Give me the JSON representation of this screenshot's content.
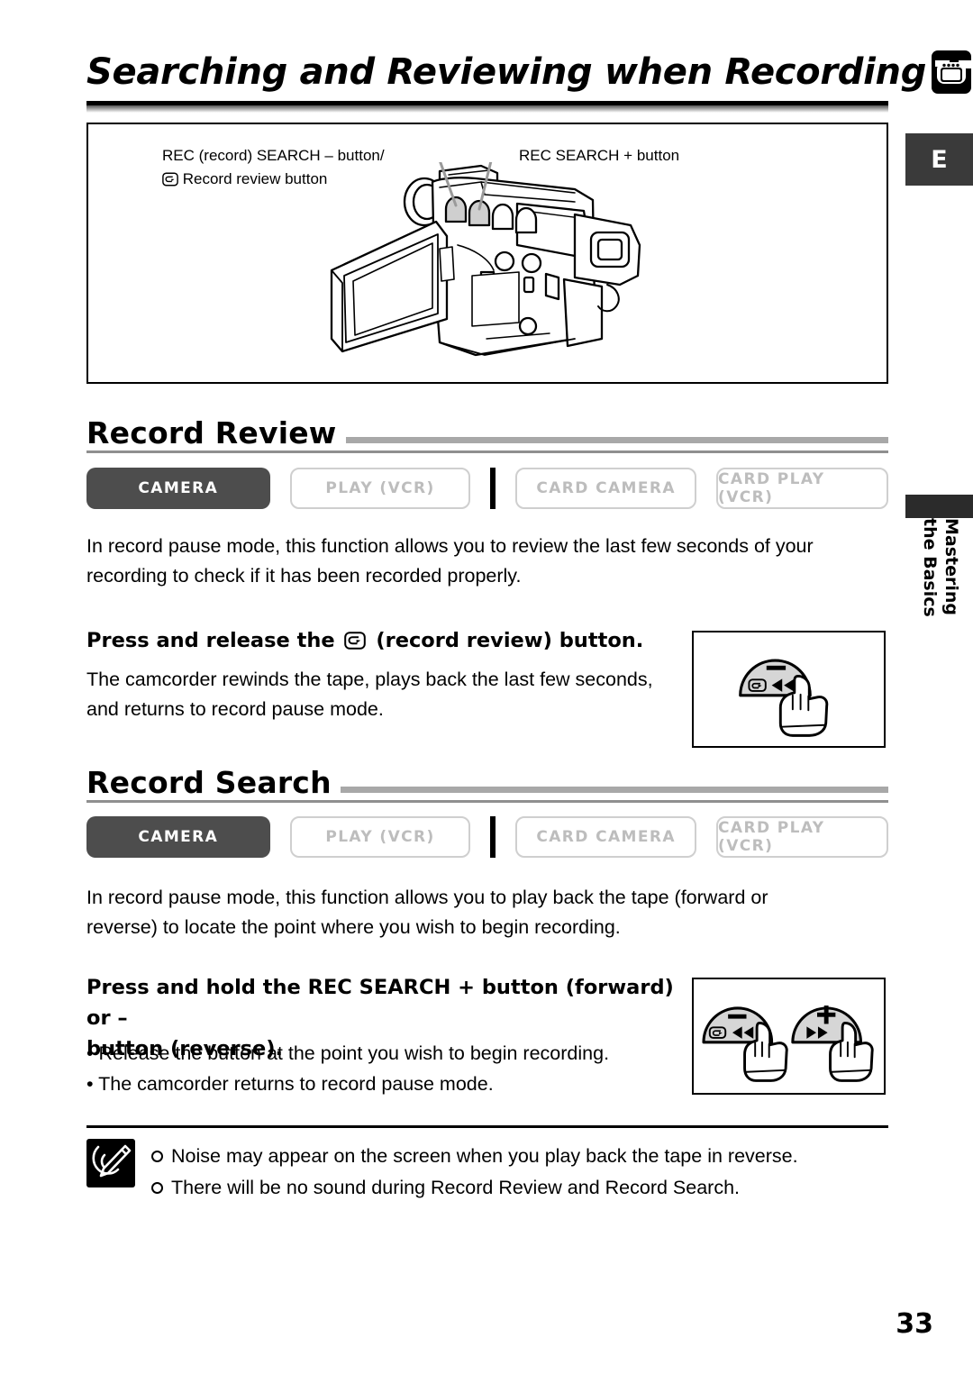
{
  "page": {
    "title": "Searching and Reviewing when Recording",
    "title_icon": "camcorder-icon",
    "number": "33",
    "side_tab_letter": "E",
    "side_tab_text_line1": "Mastering",
    "side_tab_text_line2": "the Basics"
  },
  "figure": {
    "label_left_line1": "REC (record) SEARCH – button/",
    "label_left_line2": "Record review button",
    "label_right": "REC SEARCH + button",
    "illustration": "camcorder-line-art"
  },
  "sections": [
    {
      "heading": "Record Review",
      "modes": [
        {
          "label": "CAMERA",
          "active": true
        },
        {
          "label": "PLAY (VCR)",
          "active": false
        },
        {
          "label": "CARD CAMERA",
          "active": false
        },
        {
          "label": "CARD PLAY (VCR)",
          "active": false
        }
      ],
      "intro_line1": "In record pause mode, this function allows you to review the last few seconds of your",
      "intro_line2": "recording to check if it has been recorded properly.",
      "instruction_prefix": "Press and release the",
      "instruction_suffix": "(record review) button.",
      "detail_line1": "The camcorder rewinds the tape, plays back the last few seconds,",
      "detail_line2": "and returns to record pause mode.",
      "button_figure": {
        "buttons": [
          {
            "sign": "–",
            "review_icon": true,
            "arrows": "◀◀"
          }
        ]
      }
    },
    {
      "heading": "Record Search",
      "modes": [
        {
          "label": "CAMERA",
          "active": true
        },
        {
          "label": "PLAY (VCR)",
          "active": false
        },
        {
          "label": "CARD CAMERA",
          "active": false
        },
        {
          "label": "CARD PLAY (VCR)",
          "active": false
        }
      ],
      "intro_line1": "In record pause mode, this function allows you to play back the tape (forward or",
      "intro_line2": "reverse) to locate the point where you wish to begin recording.",
      "instruction_line1": "Press and hold the REC SEARCH + button (forward) or –",
      "instruction_line2": "button (reverse).",
      "bullets": [
        "• Release the button at the point you wish to begin recording.",
        "• The camcorder returns to record pause mode."
      ],
      "button_figure": {
        "buttons": [
          {
            "sign": "–",
            "review_icon": true,
            "arrows": "◀◀"
          },
          {
            "sign": "+",
            "review_icon": false,
            "arrows": "▶▶"
          }
        ]
      }
    }
  ],
  "notes": {
    "icon": "memo-pencil-icon",
    "items": [
      "Noise may appear on the screen when you play back the tape in reverse.",
      "There will be no sound during Record Review and Record Search."
    ]
  },
  "colors": {
    "active_badge_bg": "#4d4d4d",
    "inactive_badge_border": "#cfcfcf",
    "inactive_badge_text": "#bdbdbd",
    "section_bar": "#a8a8a8",
    "side_tab_bg": "#3a3a3a",
    "button_fill": "#d6d6d6"
  }
}
